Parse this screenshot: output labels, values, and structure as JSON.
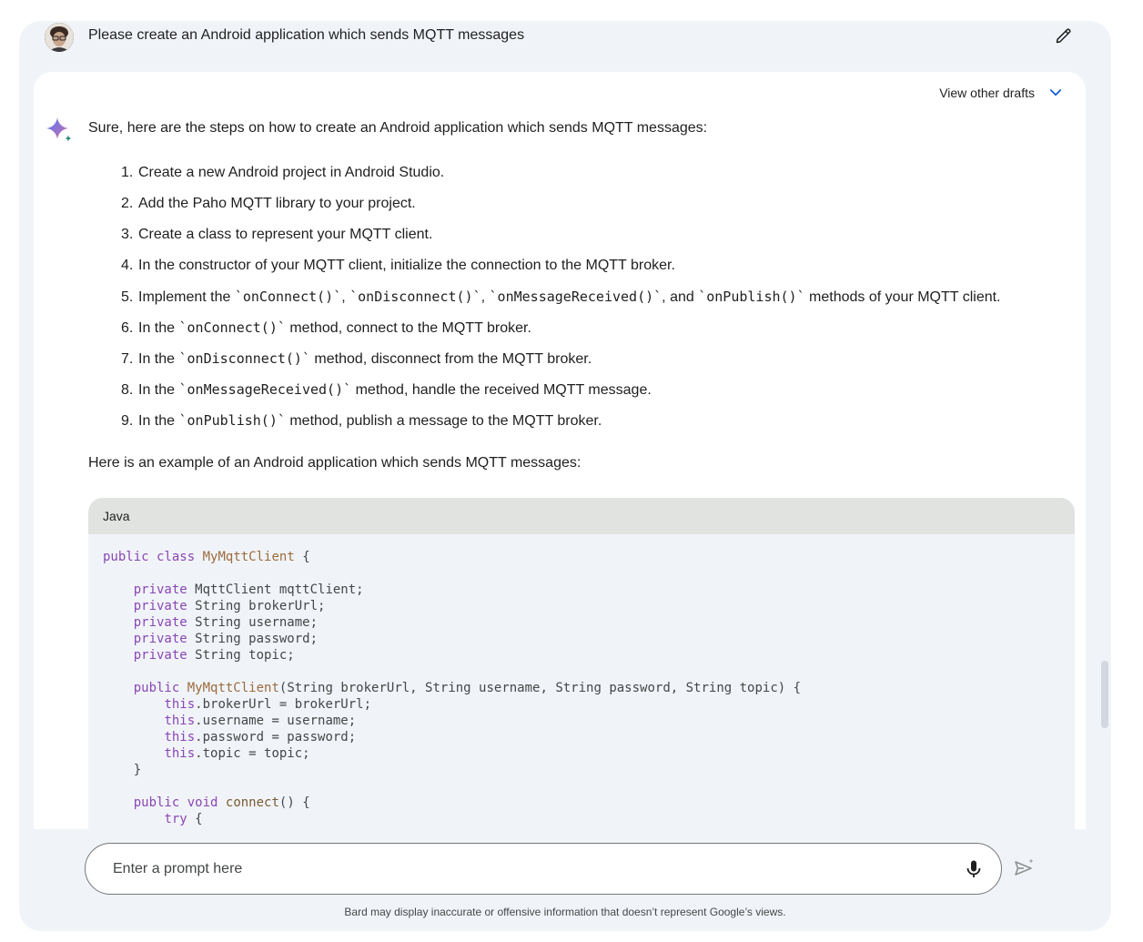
{
  "prompt": {
    "text": "Please create an Android application which sends MQTT messages"
  },
  "response": {
    "view_other_drafts": "View other drafts",
    "intro": "Sure, here are the steps on how to create an Android application which sends MQTT messages:",
    "steps": [
      {
        "num": "1.",
        "parts": [
          {
            "t": "text",
            "v": "Create a new Android project in Android Studio."
          }
        ]
      },
      {
        "num": "2.",
        "parts": [
          {
            "t": "text",
            "v": "Add the Paho MQTT library to your project."
          }
        ]
      },
      {
        "num": "3.",
        "parts": [
          {
            "t": "text",
            "v": "Create a class to represent your MQTT client."
          }
        ]
      },
      {
        "num": "4.",
        "parts": [
          {
            "t": "text",
            "v": "In the constructor of your MQTT client, initialize the connection to the MQTT broker."
          }
        ]
      },
      {
        "num": "5.",
        "parts": [
          {
            "t": "text",
            "v": "Implement the "
          },
          {
            "t": "code",
            "v": "`onConnect()`"
          },
          {
            "t": "text",
            "v": ", "
          },
          {
            "t": "code",
            "v": "`onDisconnect()`"
          },
          {
            "t": "text",
            "v": ", "
          },
          {
            "t": "code",
            "v": "`onMessageReceived()`"
          },
          {
            "t": "text",
            "v": ", and "
          },
          {
            "t": "code",
            "v": "`onPublish()`"
          },
          {
            "t": "text",
            "v": " methods of your MQTT client."
          }
        ]
      },
      {
        "num": "6.",
        "parts": [
          {
            "t": "text",
            "v": "In the "
          },
          {
            "t": "code",
            "v": "`onConnect()`"
          },
          {
            "t": "text",
            "v": " method, connect to the MQTT broker."
          }
        ]
      },
      {
        "num": "7.",
        "parts": [
          {
            "t": "text",
            "v": "In the "
          },
          {
            "t": "code",
            "v": "`onDisconnect()`"
          },
          {
            "t": "text",
            "v": " method, disconnect from the MQTT broker."
          }
        ]
      },
      {
        "num": "8.",
        "parts": [
          {
            "t": "text",
            "v": "In the "
          },
          {
            "t": "code",
            "v": "`onMessageReceived()`"
          },
          {
            "t": "text",
            "v": " method, handle the received MQTT message."
          }
        ]
      },
      {
        "num": "9.",
        "parts": [
          {
            "t": "text",
            "v": "In the "
          },
          {
            "t": "code",
            "v": "`onPublish()`"
          },
          {
            "t": "text",
            "v": " method, publish a message to the MQTT broker."
          }
        ]
      }
    ],
    "example_intro": "Here is an example of an Android application which sends MQTT messages:",
    "code": {
      "language": "Java",
      "lines": [
        [
          {
            "c": "kw",
            "v": "public"
          },
          {
            "c": "",
            "v": " "
          },
          {
            "c": "kw",
            "v": "class"
          },
          {
            "c": "",
            "v": " "
          },
          {
            "c": "cls",
            "v": "MyMqttClient"
          },
          {
            "c": "",
            "v": " {"
          }
        ],
        [],
        [
          {
            "c": "",
            "v": "    "
          },
          {
            "c": "kw",
            "v": "private"
          },
          {
            "c": "",
            "v": " MqttClient mqttClient;"
          }
        ],
        [
          {
            "c": "",
            "v": "    "
          },
          {
            "c": "kw",
            "v": "private"
          },
          {
            "c": "",
            "v": " String brokerUrl;"
          }
        ],
        [
          {
            "c": "",
            "v": "    "
          },
          {
            "c": "kw",
            "v": "private"
          },
          {
            "c": "",
            "v": " String username;"
          }
        ],
        [
          {
            "c": "",
            "v": "    "
          },
          {
            "c": "kw",
            "v": "private"
          },
          {
            "c": "",
            "v": " String password;"
          }
        ],
        [
          {
            "c": "",
            "v": "    "
          },
          {
            "c": "kw",
            "v": "private"
          },
          {
            "c": "",
            "v": " String topic;"
          }
        ],
        [],
        [
          {
            "c": "",
            "v": "    "
          },
          {
            "c": "kw",
            "v": "public"
          },
          {
            "c": "",
            "v": " "
          },
          {
            "c": "cls",
            "v": "MyMqttClient"
          },
          {
            "c": "",
            "v": "(String brokerUrl, String username, String password, String topic) {"
          }
        ],
        [
          {
            "c": "",
            "v": "        "
          },
          {
            "c": "kw",
            "v": "this"
          },
          {
            "c": "",
            "v": ".brokerUrl = brokerUrl;"
          }
        ],
        [
          {
            "c": "",
            "v": "        "
          },
          {
            "c": "kw",
            "v": "this"
          },
          {
            "c": "",
            "v": ".username = username;"
          }
        ],
        [
          {
            "c": "",
            "v": "        "
          },
          {
            "c": "kw",
            "v": "this"
          },
          {
            "c": "",
            "v": ".password = password;"
          }
        ],
        [
          {
            "c": "",
            "v": "        "
          },
          {
            "c": "kw",
            "v": "this"
          },
          {
            "c": "",
            "v": ".topic = topic;"
          }
        ],
        [
          {
            "c": "",
            "v": "    }"
          }
        ],
        [],
        [
          {
            "c": "",
            "v": "    "
          },
          {
            "c": "kw",
            "v": "public"
          },
          {
            "c": "",
            "v": " "
          },
          {
            "c": "kw",
            "v": "void"
          },
          {
            "c": "",
            "v": " "
          },
          {
            "c": "fn",
            "v": "connect"
          },
          {
            "c": "",
            "v": "() {"
          }
        ],
        [
          {
            "c": "",
            "v": "        "
          },
          {
            "c": "kw",
            "v": "try"
          },
          {
            "c": "",
            "v": " {"
          }
        ]
      ]
    }
  },
  "input": {
    "placeholder": "Enter a prompt here",
    "value": ""
  },
  "disclaimer": "Bard may display inaccurate or offensive information that doesn’t represent Google’s views.",
  "colors": {
    "frame_bg": "#f0f4f9",
    "code_header_bg": "#e1e3e1",
    "accent_blue": "#0b57d0",
    "keyword_purple": "#8a46b5"
  },
  "icons": {
    "edit": "pencil-icon",
    "drafts_toggle": "chevron-down-icon",
    "bard_logo": "sparkle-icon",
    "mic": "microphone-icon",
    "send": "send-icon"
  }
}
